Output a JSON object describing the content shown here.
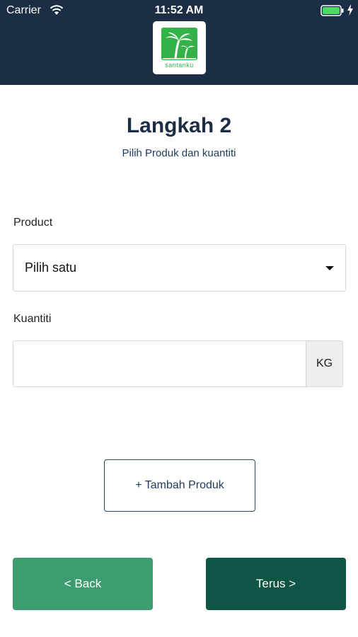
{
  "status_bar": {
    "carrier": "Carrier",
    "time": "11:52 AM"
  },
  "logo": {
    "text": "santanku",
    "brand_color": "#33b24a"
  },
  "step": {
    "title": "Langkah 2",
    "subtitle": "Pilih Produk dan kuantiti"
  },
  "form": {
    "product_label": "Product",
    "product_selected": "Pilih satu",
    "quantity_label": "Kuantiti",
    "quantity_value": "",
    "quantity_unit": "KG"
  },
  "actions": {
    "add_product": "+ Tambah Produk",
    "back": "< Back",
    "next": "Terus >"
  },
  "colors": {
    "header_bg": "#1c2e45",
    "back_button": "#3e9c71",
    "next_button": "#0f5545"
  }
}
